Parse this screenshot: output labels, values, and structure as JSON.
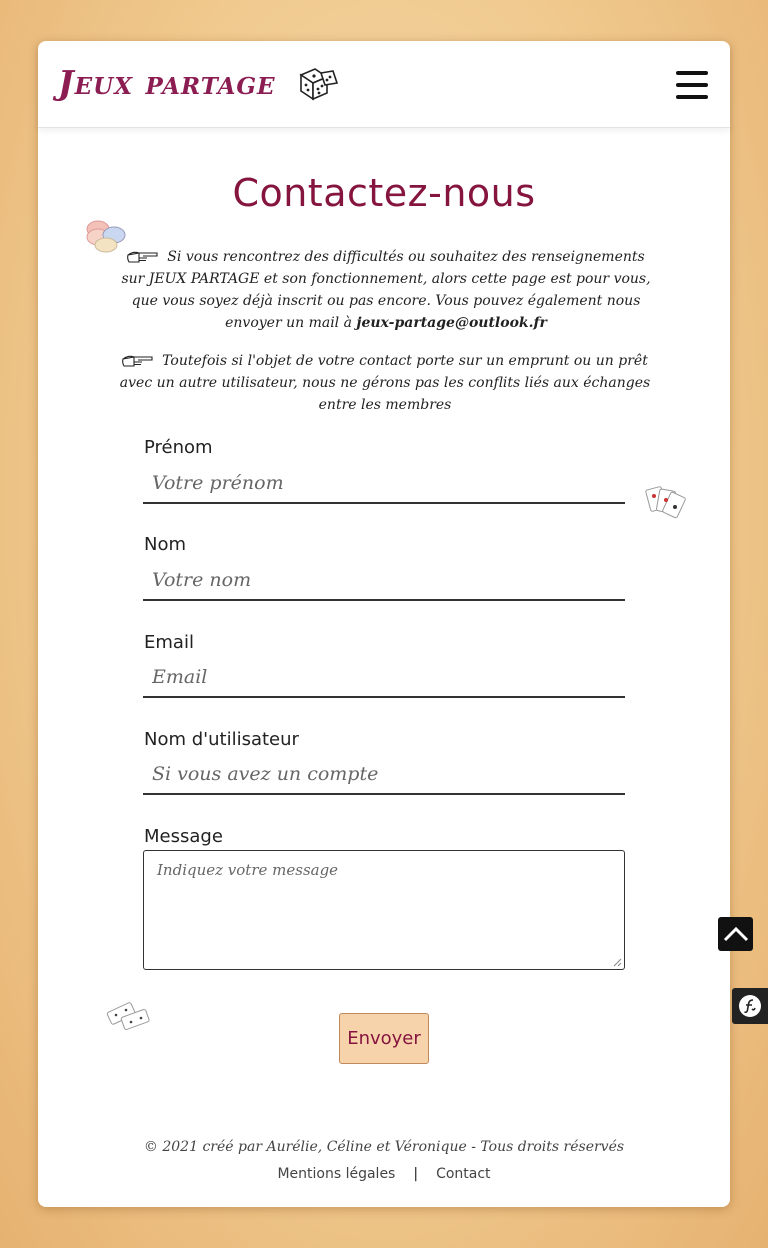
{
  "brand": {
    "name": "Jeux partage",
    "icon": "dice-icon"
  },
  "nav": {
    "menu_icon": "hamburger-menu-icon"
  },
  "page": {
    "title": "Contactez-nous",
    "intro_text": "Si vous rencontrez des difficultés ou souhaitez des renseignements sur JEUX PARTAGE et son fonctionnement, alors cette page est pour vous, que vous soyez déjà inscrit ou pas encore. Vous pouvez également nous envoyer un mail à ",
    "email": "jeux-partage@outlook.fr",
    "notice_text": "Toutefois si l'objet de votre contact porte sur un emprunt ou un prêt avec un autre utilisateur, nous ne gérons pas les conflits liés aux échanges entre les membres"
  },
  "form": {
    "firstname": {
      "label": "Prénom",
      "placeholder": "Votre prénom"
    },
    "lastname": {
      "label": "Nom",
      "placeholder": "Votre nom"
    },
    "email": {
      "label": "Email",
      "placeholder": "Email"
    },
    "username": {
      "label": "Nom d'utilisateur",
      "placeholder": "Si vous avez un compte"
    },
    "message": {
      "label": "Message",
      "placeholder": "Indiquez votre message"
    },
    "submit_label": "Envoyer"
  },
  "footer": {
    "copyright": "© 2021 créé par Aurélie, Céline et Véronique - Tous droits réservés",
    "legal_link": "Mentions légales",
    "separator": "|",
    "contact_link": "Contact"
  },
  "colors": {
    "accent": "#85153f",
    "button_bg": "#f7d3ab"
  }
}
